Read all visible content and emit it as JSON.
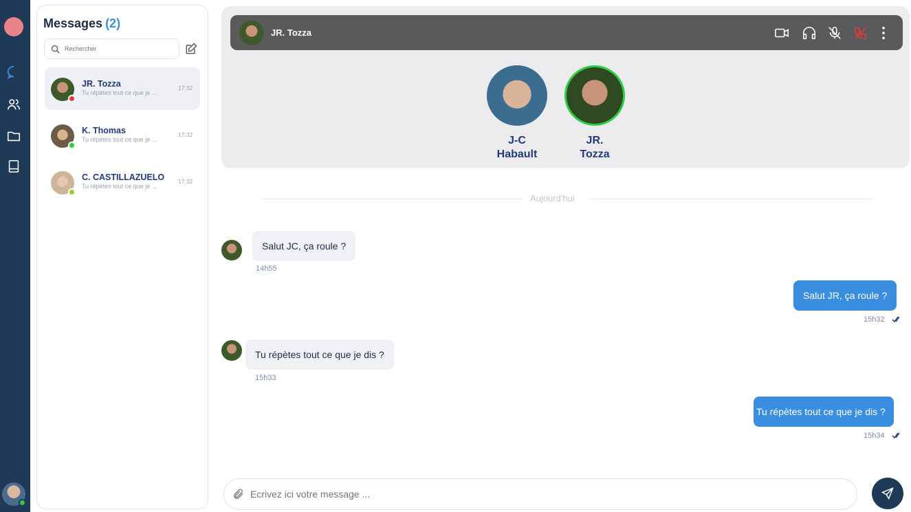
{
  "panel": {
    "title": "Messages",
    "count": "(2)",
    "search_placeholder": "Rechercher"
  },
  "conversations": [
    {
      "name": "JR. Tozza",
      "preview": "Tu répètes tout ce que je ...",
      "time": "17:32",
      "status_color": "#e53935"
    },
    {
      "name": "K. Thomas",
      "preview": "Tu répètes tout ce que je ...",
      "time": "17:32",
      "status_color": "#2ecc40"
    },
    {
      "name": "C. CASTILLAZUELO",
      "preview": "Tu répètes tout ce que je ...",
      "time": "17:32",
      "status_color": "#9acd32"
    }
  ],
  "call": {
    "name": "JR. Tozza",
    "participants": [
      {
        "line1": "J-C",
        "line2": "Habault"
      },
      {
        "line1": "JR.",
        "line2": "Tozza"
      }
    ]
  },
  "chat": {
    "divider": "Aujourd'hui",
    "messages": [
      {
        "text": "Salut JC, ça roule ?",
        "time": "14h55"
      },
      {
        "text": "Salut JR, ça roule ?",
        "time": "15h32"
      },
      {
        "text": "Tu répètes tout ce que je dis ?",
        "time": "15h33"
      },
      {
        "text": "Tu répètes tout ce que je dis ?",
        "time": "15h34"
      }
    ]
  },
  "composer": {
    "placeholder": "Ecrivez ici votre message ..."
  },
  "colors": {
    "accent": "#3a8ee0",
    "rail": "#1f3a56",
    "hangup": "#e53935",
    "online": "#2ecc40"
  }
}
